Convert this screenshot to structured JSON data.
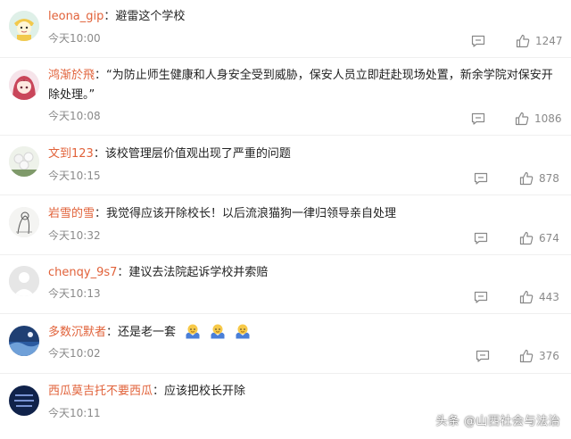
{
  "colors": {
    "username": "#e1623a",
    "meta": "#8a8a8a",
    "text": "#222222",
    "divider": "#efefef"
  },
  "comments": [
    {
      "username": "leona_gip",
      "separator": "：",
      "text": "避雷这个学校",
      "time": "今天10:00",
      "likes": "1247",
      "avatar_icon": "cartoon-avatar-icon"
    },
    {
      "username": "鸿渐於飛",
      "separator": "：",
      "text": "“为防止师生健康和人身安全受到威胁，保安人员立即赶赴现场处置，新余学院对保安开除处理。”",
      "time": "今天10:08",
      "likes": "1086",
      "avatar_icon": "anime-avatar-icon"
    },
    {
      "username": "文到123",
      "separator": "：",
      "text": "该校管理层价值观出现了严重的问题",
      "time": "今天10:15",
      "likes": "878",
      "avatar_icon": "flowers-avatar-icon"
    },
    {
      "username": "岩雪的雪",
      "separator": "：",
      "text": "我觉得应该开除校长！以后流浪猫狗一律归领导亲自处理",
      "time": "今天10:32",
      "likes": "674",
      "avatar_icon": "sketch-avatar-icon"
    },
    {
      "username": "chenqy_9s7",
      "separator": "：",
      "text": "建议去法院起诉学校并索赔",
      "time": "今天10:13",
      "likes": "443",
      "avatar_icon": "default-avatar-icon"
    },
    {
      "username": "多数沉默者",
      "separator": "：",
      "text": "还是老一套",
      "emoji_count": 3,
      "emoji_icon": "shrug-emoji-icon",
      "time": "今天10:02",
      "likes": "376",
      "avatar_icon": "landscape-avatar-icon"
    },
    {
      "username": "西瓜莫吉托不要西瓜",
      "separator": "：",
      "text": "应该把校长开除",
      "time": "今天10:11",
      "likes": "",
      "avatar_icon": "text-avatar-icon"
    }
  ],
  "watermark": "头条 @山西社会与法治"
}
